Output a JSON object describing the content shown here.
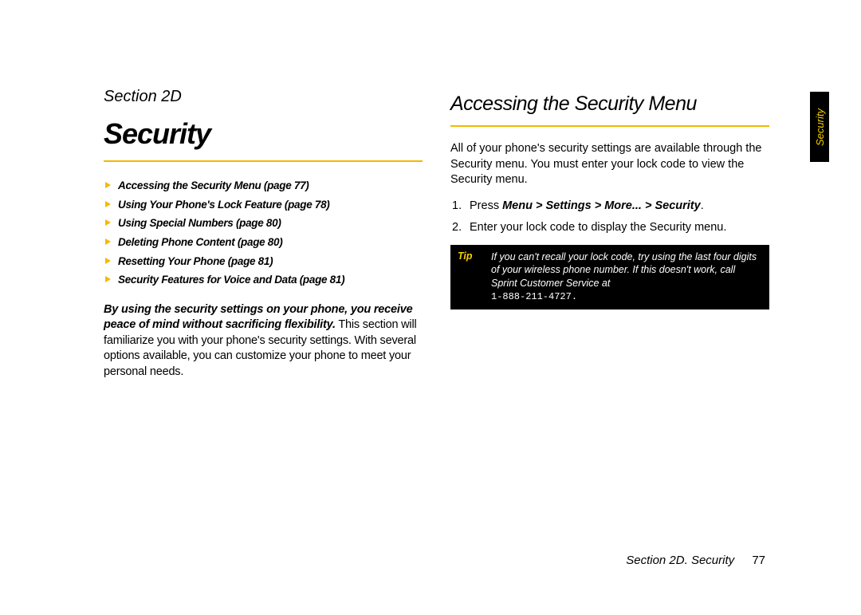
{
  "left": {
    "sectionLabel": "Section 2D",
    "title": "Security",
    "toc": [
      "Accessing the Security Menu (page 77)",
      "Using Your Phone's Lock Feature (page 78)",
      "Using Special Numbers (page 80)",
      "Deleting Phone Content (page 80)",
      "Resetting Your Phone (page 81)",
      "Security Features for Voice and Data (page 81)"
    ],
    "introLead": "By using the security settings on your phone, you receive peace of mind without sacrificing flexibility.",
    "introRest": " This section will familiarize you with your phone's security settings. With several options available, you can customize your phone to meet your personal needs."
  },
  "right": {
    "heading": "Accessing the Security Menu",
    "para1": "All of your phone's security settings are available through the Security menu. You must enter your lock code to view the Security menu.",
    "step1_pre": "Press ",
    "step1_path": "Menu > Settings > More... > Security",
    "step1_post": ".",
    "step2": "Enter your lock code to display the Security menu.",
    "tipLabel": "Tip",
    "tipBody": "If you can't recall your lock code, try using the last four digits of your wireless phone number. If this doesn't work, call Sprint Customer Service at ",
    "tipPhone": "1-888-211-4727."
  },
  "thumbTab": "Security",
  "footer": {
    "text": "Section 2D. Security",
    "page": "77"
  }
}
